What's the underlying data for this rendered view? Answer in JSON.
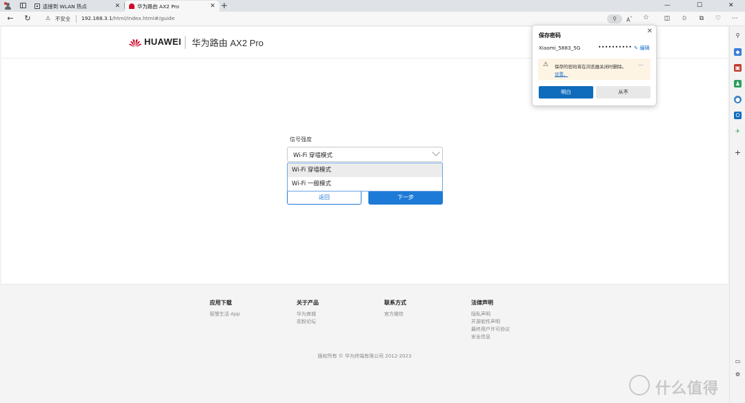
{
  "browser": {
    "tabs": [
      {
        "label": "连接到 WLAN 热点",
        "icon": "wifi-icon",
        "active": false
      },
      {
        "label": "华为路由 AX2 Pro",
        "icon": "huawei-icon",
        "active": true
      }
    ],
    "close_glyph": "✕",
    "new_tab_glyph": "+",
    "window_controls": {
      "minimize": "—",
      "maximize": "☐",
      "close": "✕"
    },
    "address": {
      "security_label": "不安全",
      "url_host": "192.168.3.1",
      "url_path": "/html/index.html#/guide"
    }
  },
  "router_header": {
    "brand": "HUAWEI",
    "product": "华为路由 AX2 Pro"
  },
  "form": {
    "label": "信号强度",
    "selected_value": "Wi-Fi 穿墙模式",
    "options": [
      "Wi-Fi 穿墙模式",
      "Wi-Fi 一般模式"
    ],
    "back_label": "返回",
    "next_label": "下一步"
  },
  "footer": {
    "columns": [
      {
        "title": "应用下载",
        "links": [
          "智慧生活 App"
        ]
      },
      {
        "title": "关于产品",
        "links": [
          "华为商城",
          "花粉论坛"
        ]
      },
      {
        "title": "联系方式",
        "links": [
          "官方微信"
        ]
      },
      {
        "title": "法律声明",
        "links": [
          "隐私声明",
          "开源软件声明",
          "最终用户许可协议",
          "安全信息"
        ]
      }
    ],
    "copyright": "版权所有 © 华为终端有限公司 2012-2023"
  },
  "password_popup": {
    "title": "保存密码",
    "username": "Xiaomi_5883_5G",
    "password_mask": "••••••••••",
    "edit_label": "编辑",
    "warning_text": "保存的密码将在浏览器关闭时删除。",
    "warning_link": "设置。",
    "more_glyph": "...",
    "ok_label": "明白",
    "never_label": "从不"
  },
  "watermark": {
    "text": "什么值得买"
  },
  "colors": {
    "huawei_red": "#cf0a2c",
    "primary_blue": "#1e7ad7",
    "edge_blue": "#0f6cbd"
  }
}
